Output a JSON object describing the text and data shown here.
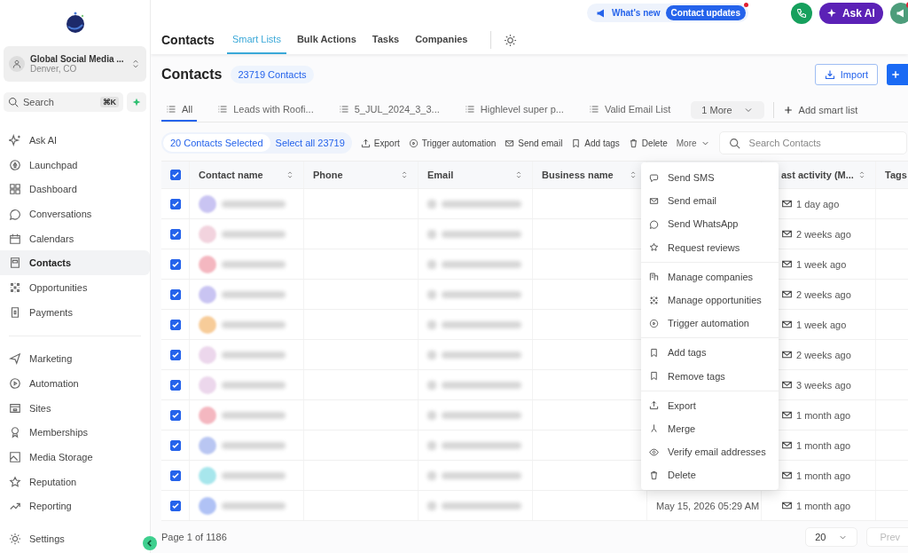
{
  "sidebar": {
    "account": {
      "name": "Global Social Media ...",
      "location": "Denver, CO"
    },
    "search": {
      "placeholder": "Search",
      "shortcut": "⌘K"
    },
    "groups": [
      [
        {
          "label": "Ask AI",
          "selected": false
        },
        {
          "label": "Launchpad",
          "selected": false
        },
        {
          "label": "Dashboard",
          "selected": false
        },
        {
          "label": "Conversations",
          "selected": false
        },
        {
          "label": "Calendars",
          "selected": false
        },
        {
          "label": "Contacts",
          "selected": true
        },
        {
          "label": "Opportunities",
          "selected": false
        },
        {
          "label": "Payments",
          "selected": false
        }
      ],
      [
        {
          "label": "Marketing",
          "selected": false
        },
        {
          "label": "Automation",
          "selected": false
        },
        {
          "label": "Sites",
          "selected": false
        },
        {
          "label": "Memberships",
          "selected": false
        },
        {
          "label": "Media Storage",
          "selected": false
        },
        {
          "label": "Reputation",
          "selected": false
        },
        {
          "label": "Reporting",
          "selected": false
        }
      ]
    ],
    "settings": "Settings"
  },
  "topbar": {
    "whats_new": "What's new",
    "update_badge": "Contact updates",
    "ask_ai": "Ask AI"
  },
  "nav": {
    "title": "Contacts",
    "tabs": [
      {
        "label": "Smart Lists",
        "selected": true
      },
      {
        "label": "Bulk Actions",
        "selected": false
      },
      {
        "label": "Tasks",
        "selected": false
      },
      {
        "label": "Companies",
        "selected": false
      }
    ]
  },
  "header": {
    "title": "Contacts",
    "count": "23719 Contacts",
    "import": "Import"
  },
  "smart_lists": {
    "tabs": [
      {
        "label": "All",
        "selected": true
      },
      {
        "label": "Leads with Roofi...",
        "selected": false
      },
      {
        "label": "5_JUL_2024_3_3...",
        "selected": false
      },
      {
        "label": "Highlevel super p...",
        "selected": false
      },
      {
        "label": "Valid Email List",
        "selected": false
      }
    ],
    "more": "1 More",
    "add": "Add smart list"
  },
  "bulk": {
    "selected": "20 Contacts Selected",
    "select_all": "Select all 23719",
    "actions": [
      "Export",
      "Trigger automation",
      "Send email",
      "Add tags",
      "Delete"
    ],
    "more": "More",
    "more_expanded": true,
    "search_placeholder": "Search Contacts"
  },
  "table": {
    "all_checked": true,
    "columns": [
      "Contact name",
      "Phone",
      "Email",
      "Business name",
      "ast activity (M...",
      "Tags"
    ],
    "rows": [
      {
        "checked": true,
        "color": "#c9c4f2",
        "last_activity": "1 day ago"
      },
      {
        "checked": true,
        "color": "#f2d3de",
        "last_activity": "2 weeks ago"
      },
      {
        "checked": true,
        "color": "#f4b7c0",
        "last_activity": "1 week ago"
      },
      {
        "checked": true,
        "color": "#c9c4f2",
        "last_activity": "2 weeks ago"
      },
      {
        "checked": true,
        "color": "#f7cc99",
        "last_activity": "1 week ago"
      },
      {
        "checked": true,
        "color": "#ecd7ec",
        "last_activity": "2 weeks ago"
      },
      {
        "checked": true,
        "color": "#ecd7ec",
        "last_activity": "3 weeks ago"
      },
      {
        "checked": true,
        "color": "#f4b7c0",
        "last_activity": "1 month ago"
      },
      {
        "checked": true,
        "color": "#b9c6f2",
        "last_activity": "1 month ago"
      },
      {
        "checked": true,
        "color": "#a7e6ec",
        "last_activity": "1 month ago"
      },
      {
        "checked": true,
        "color": "#b0c2f5",
        "created": "May 15, 2026 05:29 AM",
        "last_activity": "1 month ago"
      }
    ]
  },
  "more_menu": [
    [
      "Send SMS",
      "Send email",
      "Send WhatsApp",
      "Request reviews"
    ],
    [
      "Manage companies",
      "Manage opportunities",
      "Trigger automation"
    ],
    [
      "Add tags",
      "Remove tags"
    ],
    [
      "Export",
      "Merge",
      "Verify email addresses",
      "Delete"
    ]
  ],
  "footer": {
    "page": "Page 1 of 1186",
    "page_size": "20",
    "prev": "Prev",
    "prev_disabled": true
  }
}
